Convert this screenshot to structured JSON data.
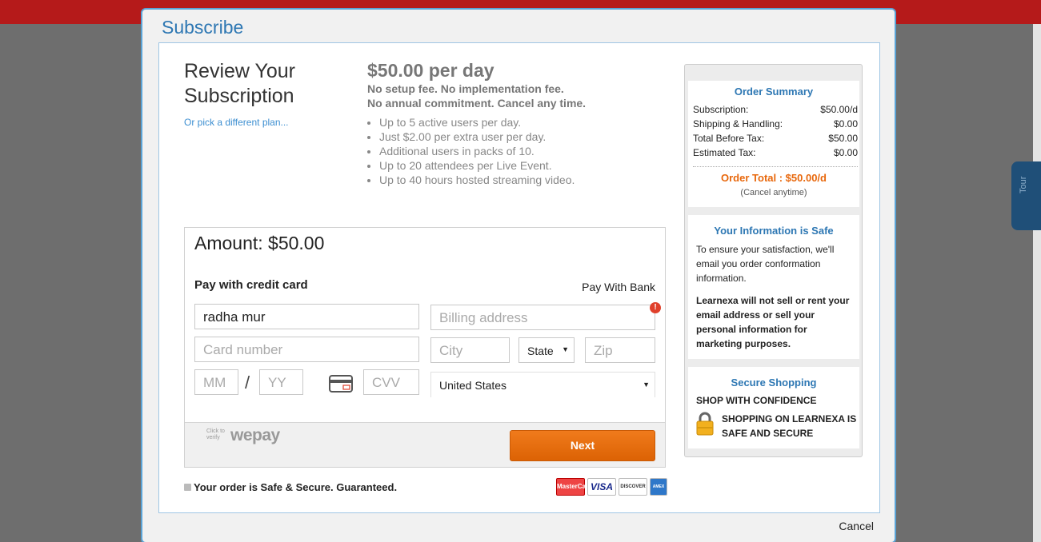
{
  "modal": {
    "title": "Subscribe",
    "cancel_label": "Cancel"
  },
  "review": {
    "title": "Review Your Subscription",
    "pick_plan_link": "Or pick a different plan..."
  },
  "plan": {
    "price": "$50.00 per day",
    "note1": "No setup fee. No implementation fee.",
    "note2": "No annual commitment. Cancel any time.",
    "features": [
      "Up to 5 active users per day.",
      "Just $2.00 per extra user per day.",
      "Additional users in packs of 10.",
      "Up to 20 attendees per Live Event.",
      "Up to 40 hours hosted streaming video."
    ]
  },
  "payment": {
    "amount": "Amount: $50.00",
    "pay_cc_label": "Pay with credit card",
    "pay_bank_label": "Pay With Bank",
    "name_value": "radha mur",
    "card_number_placeholder": "Card number",
    "mm_placeholder": "MM",
    "yy_placeholder": "YY",
    "separator": "/",
    "cvv_placeholder": "CVV",
    "billing_placeholder": "Billing address",
    "city_placeholder": "City",
    "state_value": "State",
    "zip_placeholder": "Zip",
    "country_value": "United States",
    "wepay_small": "Click to verify",
    "wepay_logo": "wepay",
    "next_label": "Next",
    "error_glyph": "!"
  },
  "footer": {
    "safe_text": "Your order is Safe & Secure. Guaranteed.",
    "cards": [
      "MasterCard",
      "VISA",
      "DISCOVER",
      "AMEX"
    ]
  },
  "order_summary": {
    "title": "Order Summary",
    "rows": [
      {
        "label": "Subscription:",
        "value": "$50.00/d"
      },
      {
        "label": "Shipping & Handling:",
        "value": "$0.00"
      },
      {
        "label": "Total Before Tax:",
        "value": "$50.00"
      },
      {
        "label": "Estimated Tax:",
        "value": "$0.00"
      }
    ],
    "total": "Order Total : $50.00/d",
    "cancel_note": "(Cancel anytime)"
  },
  "info_safe": {
    "title": "Your Information is Safe",
    "text1": "To ensure your satisfaction, we'll email you order conformation information.",
    "text2": "Learnexa will not sell or rent your email address or sell your personal information for marketing purposes."
  },
  "secure_shopping": {
    "title": "Secure Shopping",
    "subtitle": "SHOP WITH CONFIDENCE",
    "text": "SHOPPING ON LEARNEXA IS SAFE AND SECURE"
  },
  "background": {
    "tour_label": "Tour"
  },
  "colors": {
    "accent_blue": "#2d77b3",
    "link_blue": "#3d8fd1",
    "next_orange": "#e8670b",
    "modal_border": "#5aa3d6"
  }
}
